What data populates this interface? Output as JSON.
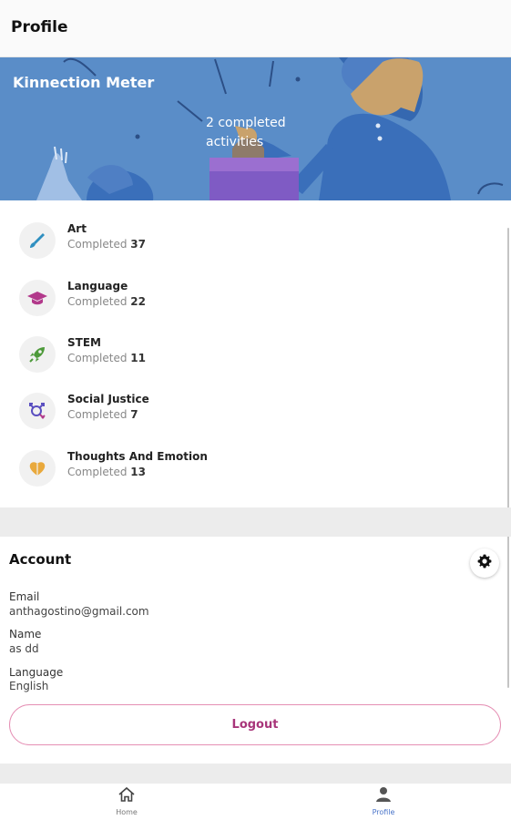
{
  "header": {
    "title": "Profile"
  },
  "banner": {
    "title": "Kinnection Meter",
    "completed_text": "2 completed activities"
  },
  "categories": [
    {
      "name": "Art",
      "label": "Completed",
      "count": "37",
      "icon": "paintbrush-icon",
      "color": "#2f8fc0"
    },
    {
      "name": "Language",
      "label": "Completed",
      "count": "22",
      "icon": "graduation-cap-icon",
      "color": "#b2398b"
    },
    {
      "name": "STEM",
      "label": "Completed",
      "count": "11",
      "icon": "rocket-icon",
      "color": "#4d9a3a"
    },
    {
      "name": "Social Justice",
      "label": "Completed",
      "count": "7",
      "icon": "gender-symbols-icon",
      "color": "#5a4fc0"
    },
    {
      "name": "Thoughts And Emotion",
      "label": "Completed",
      "count": "13",
      "icon": "heart-icon",
      "color": "#e9a93c"
    }
  ],
  "account": {
    "title": "Account",
    "email_label": "Email",
    "email_value": "anthagostino@gmail.com",
    "name_label": "Name",
    "name_value": "as dd",
    "language_label": "Language",
    "language_value": "English",
    "logout_label": "Logout"
  },
  "tabs": {
    "home": "Home",
    "profile": "Profile"
  },
  "colors": {
    "banner": "#5a8dc8",
    "accent_pink": "#a8357a",
    "tab_active": "#4a74c9"
  }
}
